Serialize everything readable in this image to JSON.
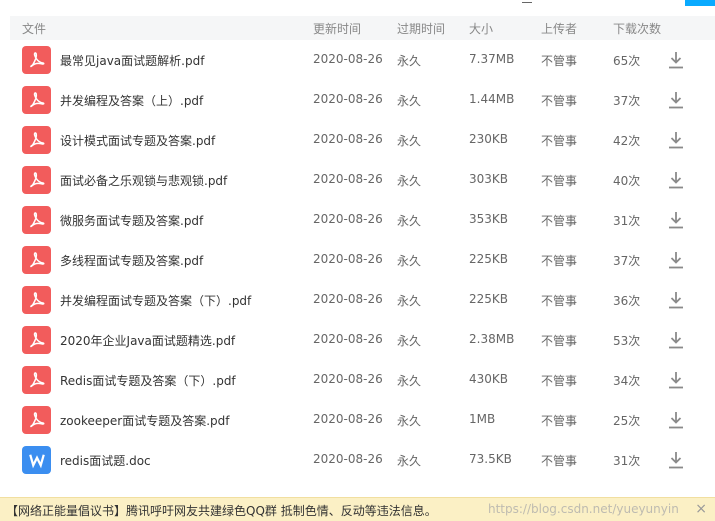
{
  "colors": {
    "pdf_icon": "#f25c5c",
    "doc_icon": "#3b8ef0",
    "header_bg": "#f5f6f7",
    "notice_bg": "#fbf0c5",
    "accent": "#09aaff"
  },
  "header": {
    "file": "文件",
    "updated": "更新时间",
    "expires": "过期时间",
    "size": "大小",
    "uploader": "上传者",
    "downloads": "下载次数"
  },
  "files": [
    {
      "name": "最常见java面试题解析.pdf",
      "type": "pdf",
      "date": "2020-08-26",
      "expire": "永久",
      "size": "7.37MB",
      "uploader": "不管事",
      "downloads": "65次"
    },
    {
      "name": "并发编程及答案（上）.pdf",
      "type": "pdf",
      "date": "2020-08-26",
      "expire": "永久",
      "size": "1.44MB",
      "uploader": "不管事",
      "downloads": "37次"
    },
    {
      "name": "设计模式面试专题及答案.pdf",
      "type": "pdf",
      "date": "2020-08-26",
      "expire": "永久",
      "size": "230KB",
      "uploader": "不管事",
      "downloads": "42次"
    },
    {
      "name": "面试必备之乐观锁与悲观锁.pdf",
      "type": "pdf",
      "date": "2020-08-26",
      "expire": "永久",
      "size": "303KB",
      "uploader": "不管事",
      "downloads": "40次"
    },
    {
      "name": "微服务面试专题及答案.pdf",
      "type": "pdf",
      "date": "2020-08-26",
      "expire": "永久",
      "size": "353KB",
      "uploader": "不管事",
      "downloads": "31次"
    },
    {
      "name": "多线程面试专题及答案.pdf",
      "type": "pdf",
      "date": "2020-08-26",
      "expire": "永久",
      "size": "225KB",
      "uploader": "不管事",
      "downloads": "37次"
    },
    {
      "name": "并发编程面试专题及答案（下）.pdf",
      "type": "pdf",
      "date": "2020-08-26",
      "expire": "永久",
      "size": "225KB",
      "uploader": "不管事",
      "downloads": "36次"
    },
    {
      "name": "2020年企业Java面试题精选.pdf",
      "type": "pdf",
      "date": "2020-08-26",
      "expire": "永久",
      "size": "2.38MB",
      "uploader": "不管事",
      "downloads": "53次"
    },
    {
      "name": "Redis面试专题及答案（下）.pdf",
      "type": "pdf",
      "date": "2020-08-26",
      "expire": "永久",
      "size": "430KB",
      "uploader": "不管事",
      "downloads": "34次"
    },
    {
      "name": "zookeeper面试专题及答案.pdf",
      "type": "pdf",
      "date": "2020-08-26",
      "expire": "永久",
      "size": "1MB",
      "uploader": "不管事",
      "downloads": "25次"
    },
    {
      "name": "redis面试题.doc",
      "type": "doc",
      "date": "2020-08-26",
      "expire": "永久",
      "size": "73.5KB",
      "uploader": "不管事",
      "downloads": "31次"
    }
  ],
  "notice": {
    "text": "【网络正能量倡议书】腾讯呼吁网友共建绿色QQ群 抵制色情、反动等违法信息。",
    "close": "×"
  },
  "watermark": "https://blog.csdn.net/yueyunyin"
}
